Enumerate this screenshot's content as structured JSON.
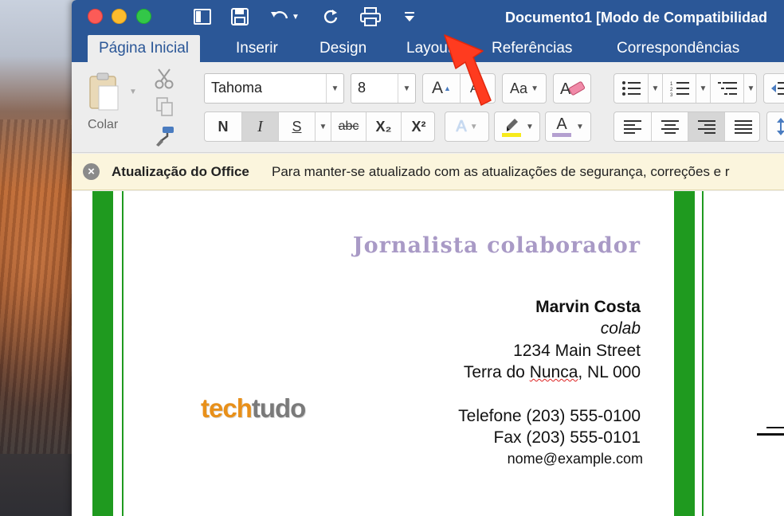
{
  "window": {
    "title": "Documento1 [Modo de Compatibilidad"
  },
  "tabs": [
    {
      "label": "Página Inicial",
      "active": true
    },
    {
      "label": "Inserir"
    },
    {
      "label": "Design"
    },
    {
      "label": "Layout"
    },
    {
      "label": "Referências"
    },
    {
      "label": "Correspondências"
    }
  ],
  "ribbon": {
    "paste_label": "Colar",
    "font_name": "Tahoma",
    "font_size": "8",
    "bold_label": "N",
    "italic_label": "I",
    "underline_label": "S",
    "strikethrough_label": "abc",
    "subscript_label": "X₂",
    "superscript_label": "X²",
    "grow_font_label": "A",
    "shrink_font_label": "A",
    "change_case_label": "Aa",
    "text_effects_label": "A",
    "font_color_label": "A"
  },
  "notification": {
    "title": "Atualização do Office",
    "message": "Para manter-se atualizado com as atualizações de segurança, correções e r"
  },
  "document": {
    "heading": "Jornalista  colaborador",
    "name": "Marvin Costa",
    "role": "colab",
    "street": "1234 Main Street",
    "city_prefix": "Terra do ",
    "city_misspelled": "Nunca",
    "city_suffix": ", NL  000",
    "phone": "Telefone (203) 555-0100",
    "fax": "Fax (203) 555-0101",
    "email": "nome@example.com",
    "logo_part1": "tech",
    "logo_part2": "tudo"
  },
  "colors": {
    "titlebar": "#2b5797",
    "heading_purple": "#a99ac6",
    "border_green": "#1f9a1f",
    "annotation_arrow": "#ff3b1f"
  }
}
